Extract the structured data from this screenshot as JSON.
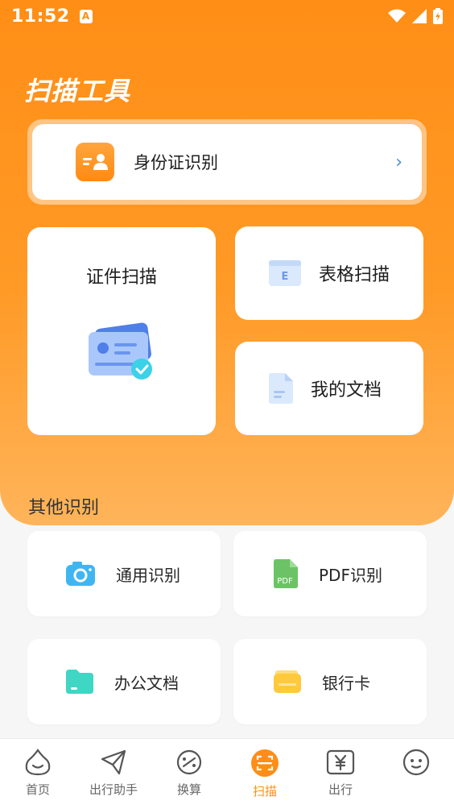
{
  "status_bar": {
    "time": "11:52",
    "notification_badge": "A"
  },
  "header": {
    "title": "扫描工具"
  },
  "id_card_feature": {
    "label": "身份证识别",
    "chevron": "›"
  },
  "features": {
    "certificate_scan": {
      "label": "证件扫描"
    },
    "table_scan": {
      "label": "表格扫描",
      "icon_letter": "E"
    },
    "my_documents": {
      "label": "我的文档"
    }
  },
  "other_section": {
    "title": "其他识别",
    "items": [
      {
        "label": "通用识别",
        "icon": "camera-icon"
      },
      {
        "label": "PDF识别",
        "icon": "pdf-icon",
        "icon_text": "PDF"
      },
      {
        "label": "办公文档",
        "icon": "folder-icon"
      },
      {
        "label": "银行卡",
        "icon": "wallet-icon"
      }
    ]
  },
  "tabbar": {
    "items": [
      {
        "label": "首页",
        "icon": "home-icon"
      },
      {
        "label": "出行助手",
        "icon": "paper-plane-icon"
      },
      {
        "label": "换算",
        "icon": "conversion-icon"
      },
      {
        "label": "扫描",
        "icon": "scan-icon",
        "active": true
      },
      {
        "label": "出行",
        "icon": "yen-icon"
      },
      {
        "label": "",
        "icon": "smiley-icon"
      }
    ]
  },
  "colors": {
    "accent": "#ff8e16",
    "accent_light": "#ffb45a",
    "chevron": "#4a8ad8",
    "camera": "#3fb6f2",
    "pdf": "#6cc366",
    "folder": "#3fd6c4",
    "wallet": "#ffc93c"
  }
}
